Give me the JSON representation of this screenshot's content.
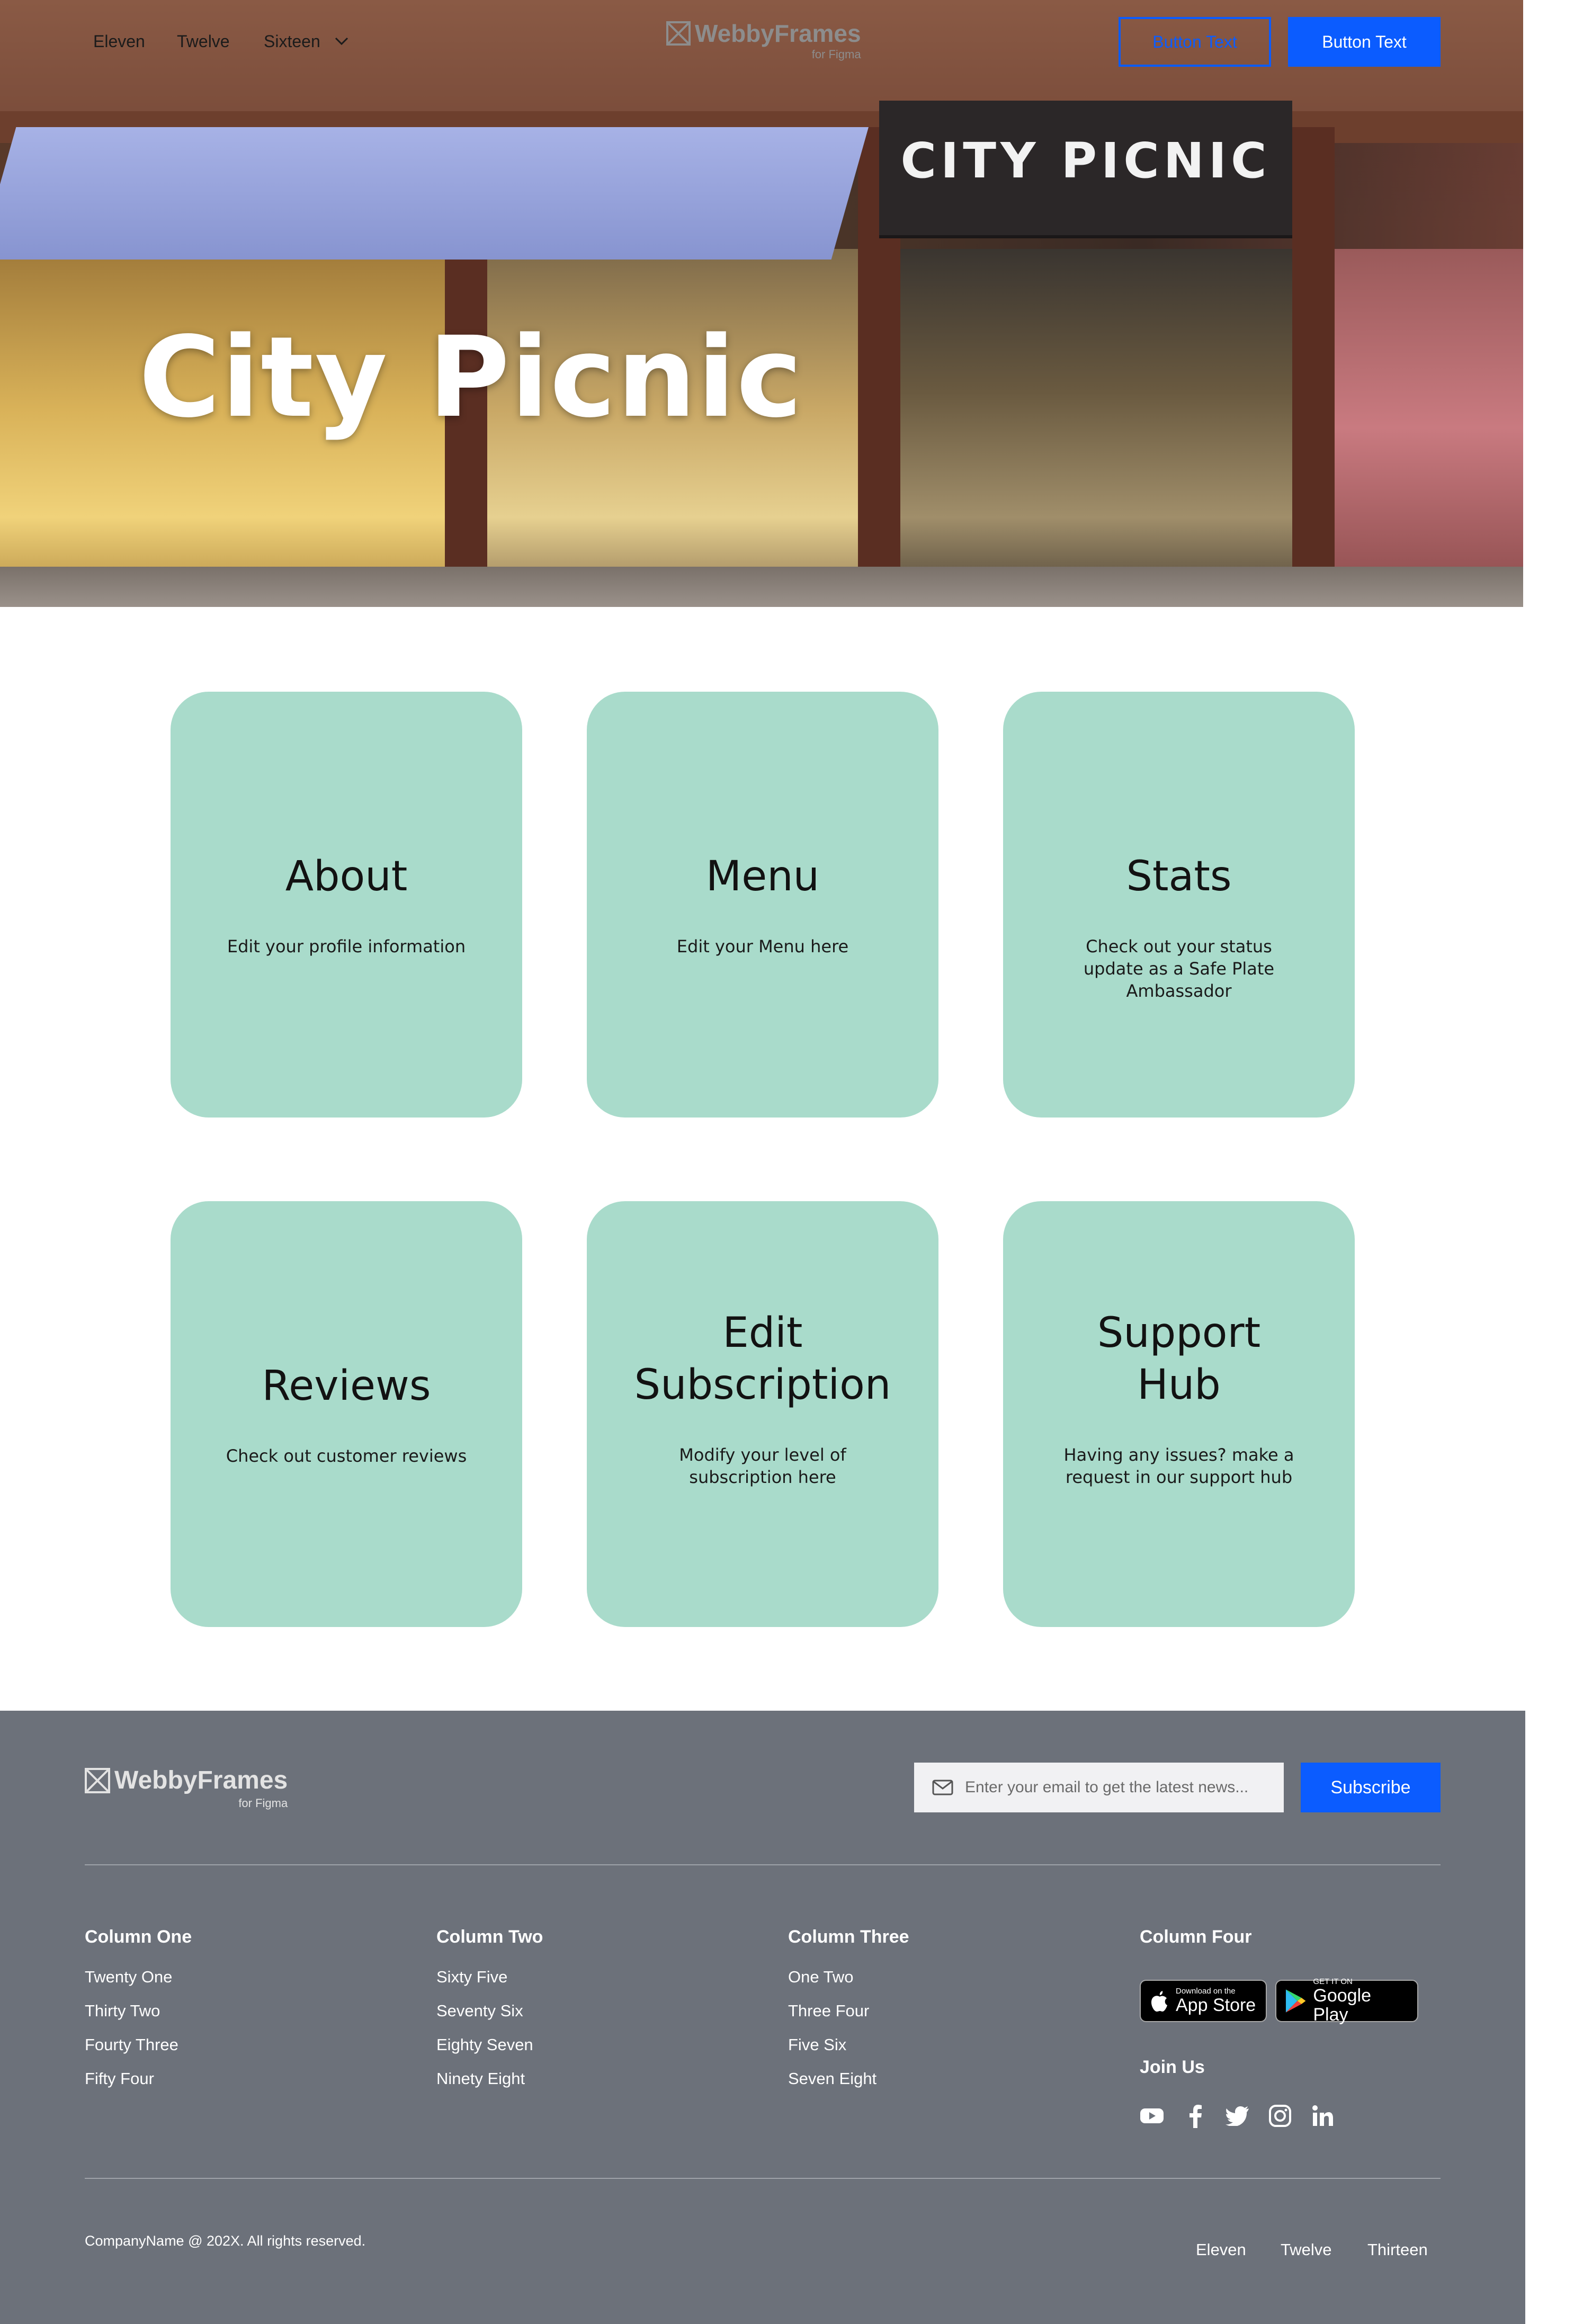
{
  "nav": {
    "links": [
      "Eleven",
      "Twelve",
      "Sixteen"
    ],
    "logo_word": "WebbyFrames",
    "logo_sub": "for Figma",
    "button_outline": "Button Text",
    "button_solid": "Button Text"
  },
  "hero": {
    "title": "City Picnic",
    "storefront_sign": "CITY PICNIC"
  },
  "cards": [
    {
      "title": "About",
      "desc": "Edit your profile information"
    },
    {
      "title": "Menu",
      "desc": "Edit your Menu here"
    },
    {
      "title": "Stats",
      "desc": "Check out your status update as a Safe Plate Ambassador"
    },
    {
      "title": "Reviews",
      "desc": "Check out customer reviews"
    },
    {
      "title": "Edit Subscription",
      "desc": "Modify your level of subscription here"
    },
    {
      "title": "Support Hub",
      "desc": "Having any issues? make a request in our support hub"
    }
  ],
  "footer": {
    "logo_word": "WebbyFrames",
    "logo_sub": "for Figma",
    "email_placeholder": "Enter your email to get the latest news...",
    "subscribe": "Subscribe",
    "columns": [
      {
        "title": "Column One",
        "links": [
          "Twenty One",
          "Thirty Two",
          "Fourty Three",
          "Fifty Four"
        ]
      },
      {
        "title": "Column Two",
        "links": [
          "Sixty Five",
          "Seventy Six",
          "Eighty Seven",
          "Ninety Eight"
        ]
      },
      {
        "title": "Column Three",
        "links": [
          "One Two",
          "Three Four",
          "Five Six",
          "Seven Eight"
        ]
      },
      {
        "title": "Column Four"
      }
    ],
    "app_store": {
      "small": "Download on the",
      "big": "App Store"
    },
    "google_play": {
      "small": "GET IT ON",
      "big": "Google Play"
    },
    "join_us": "Join Us",
    "social_icons": [
      "youtube-icon",
      "facebook-icon",
      "twitter-icon",
      "instagram-icon",
      "linkedin-icon"
    ],
    "copyright": "CompanyName @ 202X. All rights reserved.",
    "bottom_links": [
      "Eleven",
      "Twelve",
      "Thirteen"
    ]
  },
  "colors": {
    "accent": "#0b5cff",
    "card": "#a9dbcb",
    "footer": "#6c717a"
  }
}
